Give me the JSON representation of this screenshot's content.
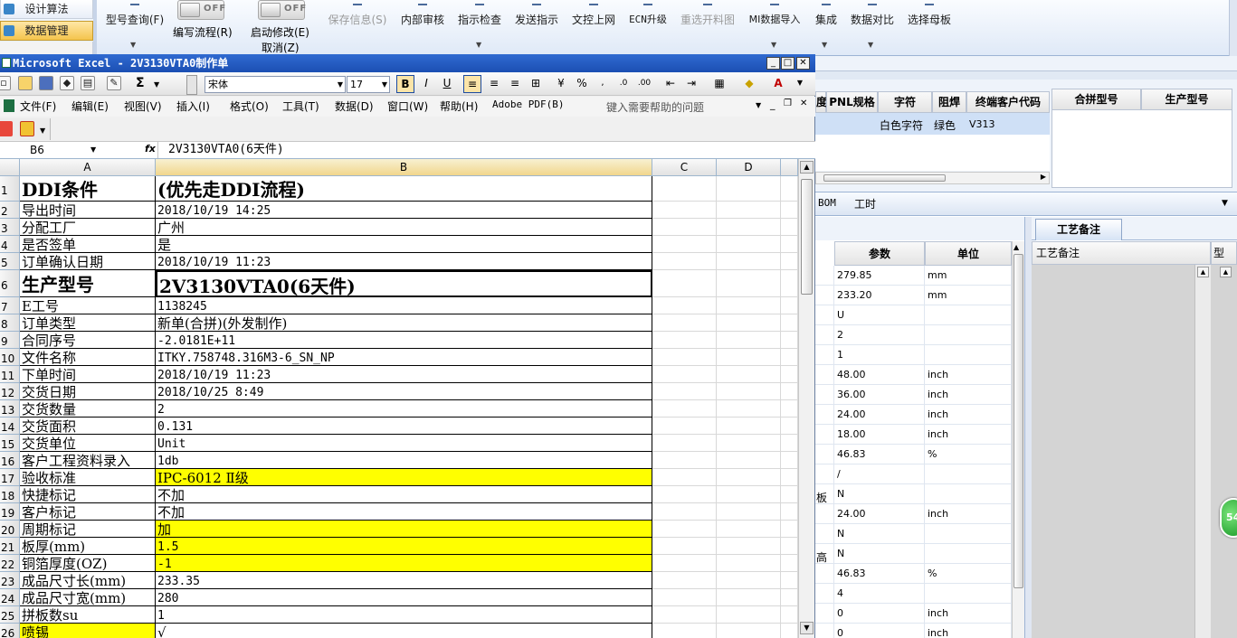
{
  "app": {
    "nav": [
      {
        "label": "设计算法",
        "active": false
      },
      {
        "label": "数据管理",
        "active": true
      }
    ],
    "ribbon": {
      "model_query": "型号查询(F)",
      "toggle_off_text": "OFF",
      "write_flow": "编写流程(R)",
      "start_modify": "启动修改(E)",
      "cancel": "取消(Z)",
      "save_info": "保存信息(S)",
      "internal_review": "内部审核",
      "instruction_check": "指示检查",
      "send_instruction": "发送指示",
      "doc_upload": "文控上网",
      "ecn_upgrade": "ECN升级",
      "reselect_drawing": "重选开料图",
      "mi_import": "MI数据导入",
      "integrate": "集成",
      "data_compare": "数据对比",
      "select_mother": "选择母板"
    },
    "top_grid": {
      "headers": [
        "PNL规格",
        "字符",
        "阻焊",
        "终端客户代码"
      ],
      "row": [
        "",
        "白色字符",
        "绿色",
        "V313"
      ],
      "partial_header": "度"
    },
    "merge_grid": {
      "headers": [
        "合拼型号",
        "生产型号"
      ]
    },
    "tabs": [
      "BOM",
      "工时"
    ],
    "params": {
      "headers": [
        "参数",
        "单位"
      ],
      "side_labels": [
        "板",
        "高"
      ],
      "rows": [
        [
          "279.85",
          "mm"
        ],
        [
          "233.20",
          "mm"
        ],
        [
          "U",
          ""
        ],
        [
          "2",
          ""
        ],
        [
          "1",
          ""
        ],
        [
          "48.00",
          "inch"
        ],
        [
          "36.00",
          "inch"
        ],
        [
          "24.00",
          "inch"
        ],
        [
          "18.00",
          "inch"
        ],
        [
          "46.83",
          "%"
        ],
        [
          "/",
          ""
        ],
        [
          "N",
          ""
        ],
        [
          "24.00",
          "inch"
        ],
        [
          "N",
          ""
        ],
        [
          "N",
          ""
        ],
        [
          "46.83",
          "%"
        ],
        [
          "4",
          ""
        ],
        [
          "0",
          "inch"
        ],
        [
          "0",
          "inch"
        ]
      ]
    },
    "notes": {
      "tab": "工艺备注",
      "header": "工艺备注",
      "partial_col": "型"
    },
    "badge": "54"
  },
  "excel": {
    "title": "Microsoft Excel - 2V3130VTA0制作单",
    "font_name": "宋体",
    "font_size": "17",
    "bold": "B",
    "italic": "I",
    "underline": "U",
    "percent": "%",
    "sigma": "Σ",
    "menus": [
      "文件(F)",
      "编辑(E)",
      "视图(V)",
      "插入(I)",
      "格式(O)",
      "工具(T)",
      "数据(D)",
      "窗口(W)",
      "帮助(H)",
      "Adobe PDF(B)"
    ],
    "help_placeholder": "键入需要帮助的问题",
    "name_box": "B6",
    "fx": "fx",
    "formula": "2V3130VTA0(6天件)",
    "columns": [
      "A",
      "B",
      "C",
      "D"
    ],
    "rows": [
      {
        "n": "1",
        "a": "DDI条件",
        "b": "(优先走DDI流程)",
        "big": true
      },
      {
        "n": "2",
        "a": "导出时间",
        "b": "2018/10/19 14:25"
      },
      {
        "n": "3",
        "a": "分配工厂",
        "b": "广州"
      },
      {
        "n": "4",
        "a": "是否签单",
        "b": "是"
      },
      {
        "n": "5",
        "a": "订单确认日期",
        "b": "2018/10/19 11:23"
      },
      {
        "n": "6",
        "a": "生产型号",
        "b": "2V3130VTA0(6天件)",
        "big": true
      },
      {
        "n": "7",
        "a": "E工号",
        "b": "1138245"
      },
      {
        "n": "8",
        "a": "订单类型",
        "b": "新单(合拼)(外发制作)"
      },
      {
        "n": "9",
        "a": "合同序号",
        "b": "-2.0181E+11"
      },
      {
        "n": "10",
        "a": "文件名称",
        "b": "ITKY.758748.316M3-6_SN_NP"
      },
      {
        "n": "11",
        "a": "下单时间",
        "b": "2018/10/19 11:23"
      },
      {
        "n": "12",
        "a": "交货日期",
        "b": "2018/10/25 8:49"
      },
      {
        "n": "13",
        "a": "交货数量",
        "b": "2"
      },
      {
        "n": "14",
        "a": "交货面积",
        "b": "0.131"
      },
      {
        "n": "15",
        "a": "交货单位",
        "b": "Unit"
      },
      {
        "n": "16",
        "a": "客户工程资料录入",
        "b": "1db"
      },
      {
        "n": "17",
        "a": "验收标准",
        "b": "IPC-6012 Ⅱ级",
        "yb": true
      },
      {
        "n": "18",
        "a": "快捷标记",
        "b": "不加"
      },
      {
        "n": "19",
        "a": "客户标记",
        "b": "不加"
      },
      {
        "n": "20",
        "a": "周期标记",
        "b": "加",
        "yb": true
      },
      {
        "n": "21",
        "a": "板厚(mm)",
        "b": "1.5",
        "yb": true
      },
      {
        "n": "22",
        "a": "铜箔厚度(OZ)",
        "b": "-1",
        "yb": true
      },
      {
        "n": "23",
        "a": "成品尺寸长(mm)",
        "b": "233.35"
      },
      {
        "n": "24",
        "a": "成品尺寸宽(mm)",
        "b": "280"
      },
      {
        "n": "25",
        "a": "拼板数su",
        "b": "1"
      },
      {
        "n": "26",
        "a": "喷锡",
        "b": "√",
        "ya": true
      }
    ]
  }
}
